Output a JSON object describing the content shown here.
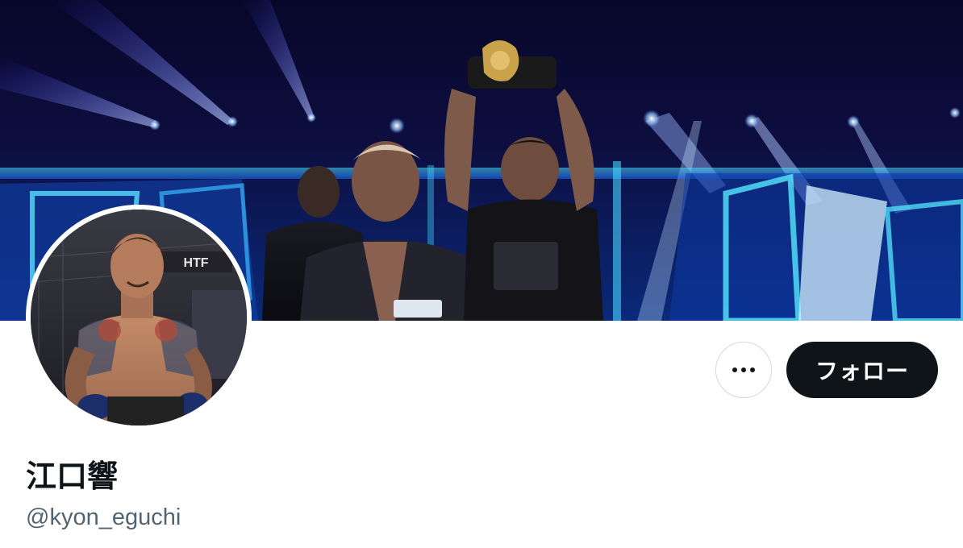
{
  "profile": {
    "display_name": "江口響",
    "handle": "@kyon_eguchi"
  },
  "actions": {
    "follow_label": "フォロー",
    "more_icon": "more-horizontal-icon"
  },
  "images": {
    "banner": "header-photo",
    "avatar": "avatar-photo"
  },
  "colors": {
    "follow_bg": "#0f1419",
    "follow_text": "#ffffff",
    "name": "#0f1419",
    "handle": "#536471",
    "border": "#cfd9de"
  }
}
